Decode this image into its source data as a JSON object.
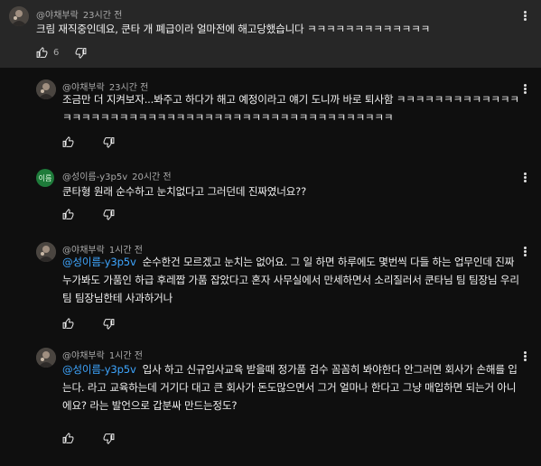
{
  "comments": [
    {
      "author": "@야채부락",
      "time": "23시간 전",
      "text": "크림 재직중인데요, 쿤타 개 폐급이라 얼마전에 해고당했습니다 ㅋㅋㅋㅋㅋㅋㅋㅋㅋㅋㅋㅋㅋ",
      "likes": "6",
      "avatar": "profile-photo"
    },
    {
      "author": "@야채부락",
      "time": "23시간 전",
      "text": "조금만 더 지켜보자...봐주고 하다가 해고 예정이라고 얘기 도니까 바로 퇴사함 ㅋㅋㅋㅋㅋㅋㅋㅋㅋㅋㅋㅋㅋㅋㅋㅋㅋㅋㅋㅋㅋㅋㅋㅋㅋㅋㅋㅋㅋㅋㅋㅋㅋㅋㅋㅋㅋㅋㅋㅋㅋㅋㅋㅋㅋㅋㅋㅋ",
      "avatar": "profile-photo"
    },
    {
      "author": "@성이름-y3p5v",
      "time": "20시간 전",
      "text": "쿤타형 원래 순수하고 눈치없다고 그러던데 진짜였너요??",
      "avatar_initials": "이름"
    },
    {
      "author": "@야채부락",
      "time": "1시간 전",
      "mention": "@성이름-y3p5v",
      "text": "순수한건 모르겠고 눈치는 없어요. 그 일 하면 하루에도 몇번씩 다들 하는 업무인데 진짜 누가봐도 가품인 하급 후레짭 가품 잡았다고 혼자 사무실에서 만세하면서 소리질러서 쿤타님 팀 팀장님 우리팀 팀장님한테 사과하거나",
      "avatar": "profile-photo"
    },
    {
      "author": "@야채부락",
      "time": "1시간 전",
      "mention": "@성이름-y3p5v",
      "text": "입사 하고 신규입사교육 받을때 정가품 검수 꼼꼼히 봐야한다 안그러면 회사가 손해를 입는다. 라고 교육하는데 거기다 대고 큰 회사가 돈도많으면서 그거 얼마나 한다고 그냥 매입하면 되는거 아니에요? 라는 발언으로 갑분싸 만드는정도?",
      "avatar": "profile-photo"
    }
  ],
  "colors": {
    "background": "#0f0f0f",
    "highlight": "#272727",
    "mention": "#3ea6ff",
    "meta": "#aaaaaa"
  },
  "icons": [
    "thumb-up-icon",
    "thumb-down-icon",
    "more-vert-icon"
  ]
}
